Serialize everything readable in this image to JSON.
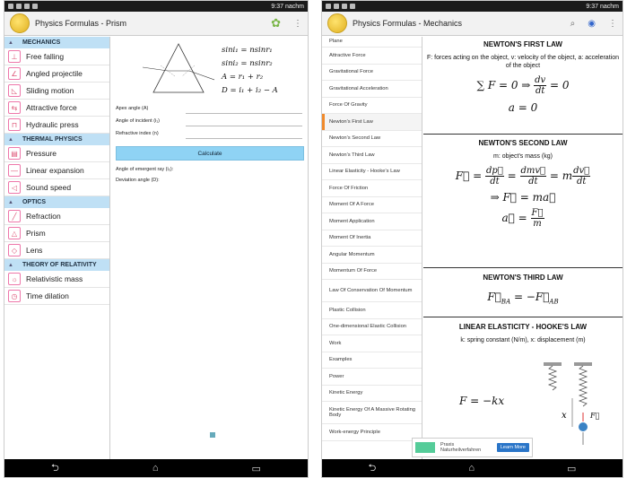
{
  "status": {
    "time": "9:37 nachm"
  },
  "left": {
    "title": "Physics Formulas - Prism",
    "categories": [
      {
        "name": "MECHANICS",
        "items": [
          "Free falling",
          "Angled projectile",
          "Sliding motion",
          "Attractive force",
          "Hydraulic press"
        ]
      },
      {
        "name": "THERMAL PHYSICS",
        "items": [
          "Pressure",
          "Linear expansion",
          "Sound speed"
        ]
      },
      {
        "name": "OPTICS",
        "items": [
          "Refraction",
          "Prism",
          "Lens"
        ]
      },
      {
        "name": "THEORY OF RELATIVITY",
        "items": [
          "Relativistic mass",
          "Time dilation"
        ]
      }
    ],
    "formulas": [
      "sini₁ = nsinr₁",
      "sini₂ = nsinr₂",
      "A = r₁ + r₂",
      "D = i₁ + i₂ − A"
    ],
    "fields": [
      "Apex angle (A)",
      "Angle of incident (i₁)",
      "Refractive index (n)"
    ],
    "calculate": "Calculate",
    "outputs": [
      "Angle of emergent ray (i₂):",
      "Deviation angle (D):"
    ]
  },
  "right": {
    "title": "Physics Formulas - Mechanics",
    "items": [
      "Plane",
      "Attractive Force",
      "Gravitational Force",
      "Gravitational Acceleration",
      "Force Of Gravity",
      "Newton's First Law",
      "Newton's Second Law",
      "Newton's Third Law",
      "Linear Elasticity - Hooke's Law",
      "Force Of Friction",
      "Moment Of A Force",
      "Moment Application",
      "Moment Of Inertia",
      "Angular Momentum",
      "Momentum Of Force",
      "Law Of Conservation Of Momentum",
      "Plastic Collision",
      "One-dimensional Elastic Collision",
      "Work",
      "Examples",
      "Power",
      "Kinetic Energy",
      "Kinetic Energy Of A Massive Rotating Body",
      "Work-energy Principle"
    ],
    "selected": "Newton's First Law",
    "laws": [
      {
        "title": "NEWTON'S FIRST LAW",
        "desc": "F: forces acting on the object, v: velocity of the object, a: acceleration of the object"
      },
      {
        "title": "NEWTON'S SECOND LAW",
        "desc": "m: object's mass (kg)"
      },
      {
        "title": "NEWTON'S THIRD LAW",
        "desc": ""
      },
      {
        "title": "LINEAR ELASTICITY - HOOKE'S LAW",
        "desc": "k: spring constant (N/m), x: displacement (m)"
      }
    ],
    "ad": {
      "brand": "Praxis",
      "text": "Naturheilverfahren",
      "button": "Learn More"
    }
  }
}
